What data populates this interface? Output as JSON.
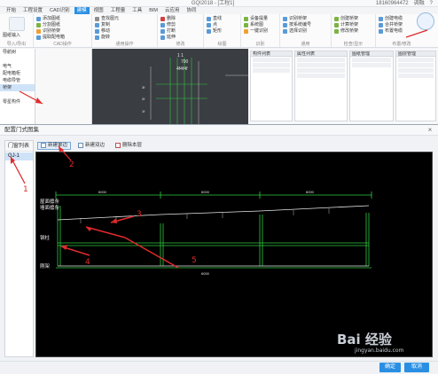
{
  "app": {
    "title": "GQI2018 - [工程1]",
    "titlebar_right": [
      "18160964472",
      "调融",
      "?"
    ],
    "menu_tabs": [
      "开始",
      "工程设置",
      "CAD识别",
      "建模",
      "视图",
      "工程量",
      "工具",
      "BIM",
      "云应用",
      "协同"
    ],
    "active_menu_index": 3,
    "cloud_label": "云检查",
    "ribbon_groups": [
      {
        "label": "导入/导出",
        "items": [
          "图纸输入",
          "定义",
          ""
        ]
      },
      {
        "label": "CAD操作",
        "items": [
          "添加图纸",
          "分割图纸",
          "识别桥架",
          "提取配电箱",
          "图纸管理"
        ]
      },
      {
        "label": "通用操作",
        "items": [
          "查找图元",
          "复制",
          "移动",
          "旋转"
        ]
      },
      {
        "label": "修改",
        "items": [
          "删除",
          "修剪",
          "打断",
          "延伸"
        ]
      },
      {
        "label": "绘图",
        "items": [
          "直线",
          "点",
          "矩形",
          "圆形"
        ]
      },
      {
        "label": "识别",
        "items": [
          "设备提量",
          "系统图",
          "一键识别",
          "自动识别"
        ]
      },
      {
        "label": "通用",
        "items": [
          "识别桥架",
          "按系统编号",
          "选择识别"
        ]
      },
      {
        "label": "检查/显示",
        "items": [
          "创建桥架",
          "计算桥架",
          "修改桥架"
        ]
      },
      {
        "label": "布置/修改",
        "items": [
          "创建电缆",
          "合并桥架",
          "布置电缆",
          "检查回路"
        ]
      }
    ],
    "left_panel_rows": [
      "导航树",
      "",
      "电气",
      "配电箱柜",
      "电缆导管",
      "桥架",
      "",
      "零星构件"
    ],
    "right_panel_heads": [
      "构件列表",
      "属性列表",
      "图纸管理",
      "图层管理"
    ],
    "cad_labels": [
      "1 1",
      "700",
      "4f4f4f",
      "3f",
      "2f",
      "1f"
    ]
  },
  "dialog": {
    "title": "配置门式图集",
    "close_glyph": "×",
    "library_header": "门窗列表",
    "library_items": [
      "GJ-1"
    ],
    "toolbar": [
      {
        "label": "新建单边",
        "icon": "new-single-icon"
      },
      {
        "label": "新建双边",
        "icon": "new-double-icon"
      },
      {
        "label": "删除本层",
        "icon": "delete-layer-icon"
      }
    ],
    "ok_label": "确定",
    "cancel_label": "取消",
    "row_labels": [
      "屋面檩条",
      "墙面檩条",
      "钢柱",
      "钢梁",
      "刚架"
    ],
    "dim_labels": [
      "6000",
      "6000",
      "6000",
      "6000"
    ],
    "annotations": [
      "1",
      "2",
      "3",
      "4",
      "5"
    ]
  },
  "watermark": {
    "text": "Bai  经验",
    "sub": "jingyan.baidu.com"
  },
  "colors": {
    "accent": "#2a8fe3",
    "annotation": "#e12a2a",
    "cad_green": "#2ecc40",
    "cad_white": "#e6e6e6"
  }
}
